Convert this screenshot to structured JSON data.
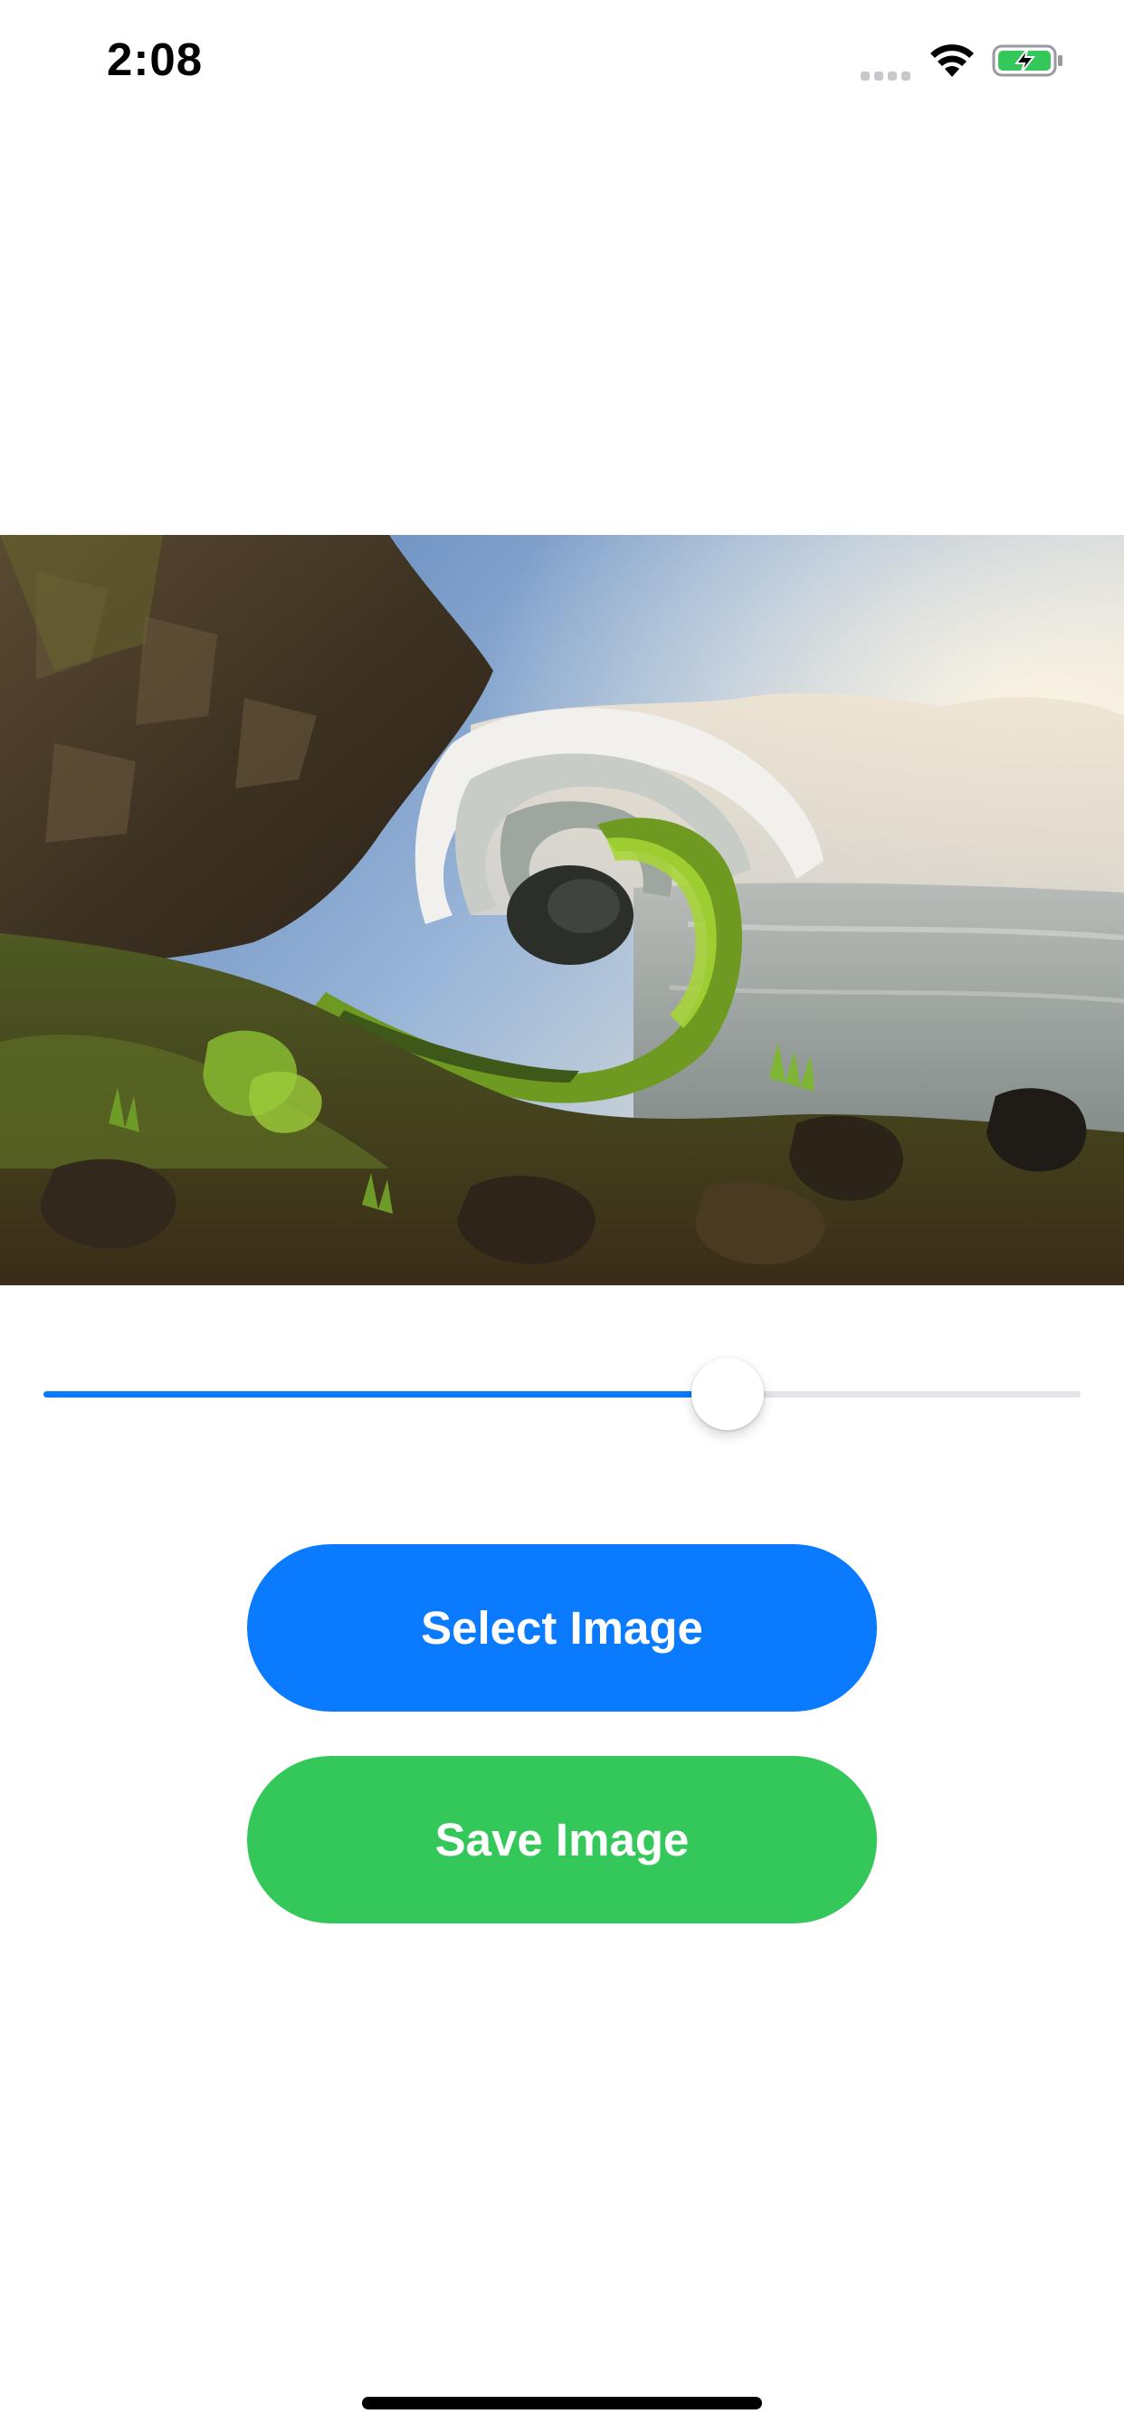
{
  "status_bar": {
    "time": "2:08",
    "icons": [
      "signal-icon",
      "wifi-icon",
      "battery-charging-icon"
    ]
  },
  "image": {
    "description_icon": "twirl-distorted-waterfall-photo"
  },
  "slider": {
    "value": 0.66,
    "track_color": "#e4e4e8",
    "fill_color": "#0a7aff"
  },
  "buttons": {
    "select_label": "Select Image",
    "select_color": "#0a7aff",
    "save_label": "Save Image",
    "save_color": "#34c759"
  }
}
